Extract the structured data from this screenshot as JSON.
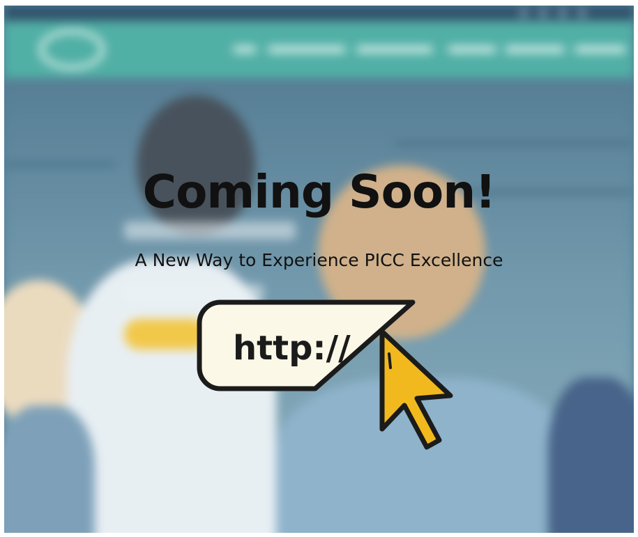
{
  "headline": "Coming Soon!",
  "subheadline": "A New Way to Experience PICC Excellence",
  "url_bar": {
    "text": "http://"
  },
  "icons": {
    "cursor": "pointer-arrow-icon"
  },
  "colors": {
    "navbar": "#3aa59a",
    "topbar": "#153a57",
    "hero_overlay": "#3f6c86",
    "url_bar_fill": "#fbf8e7",
    "cursor_fill": "#f2b91e",
    "outline": "#1b1b1b"
  }
}
